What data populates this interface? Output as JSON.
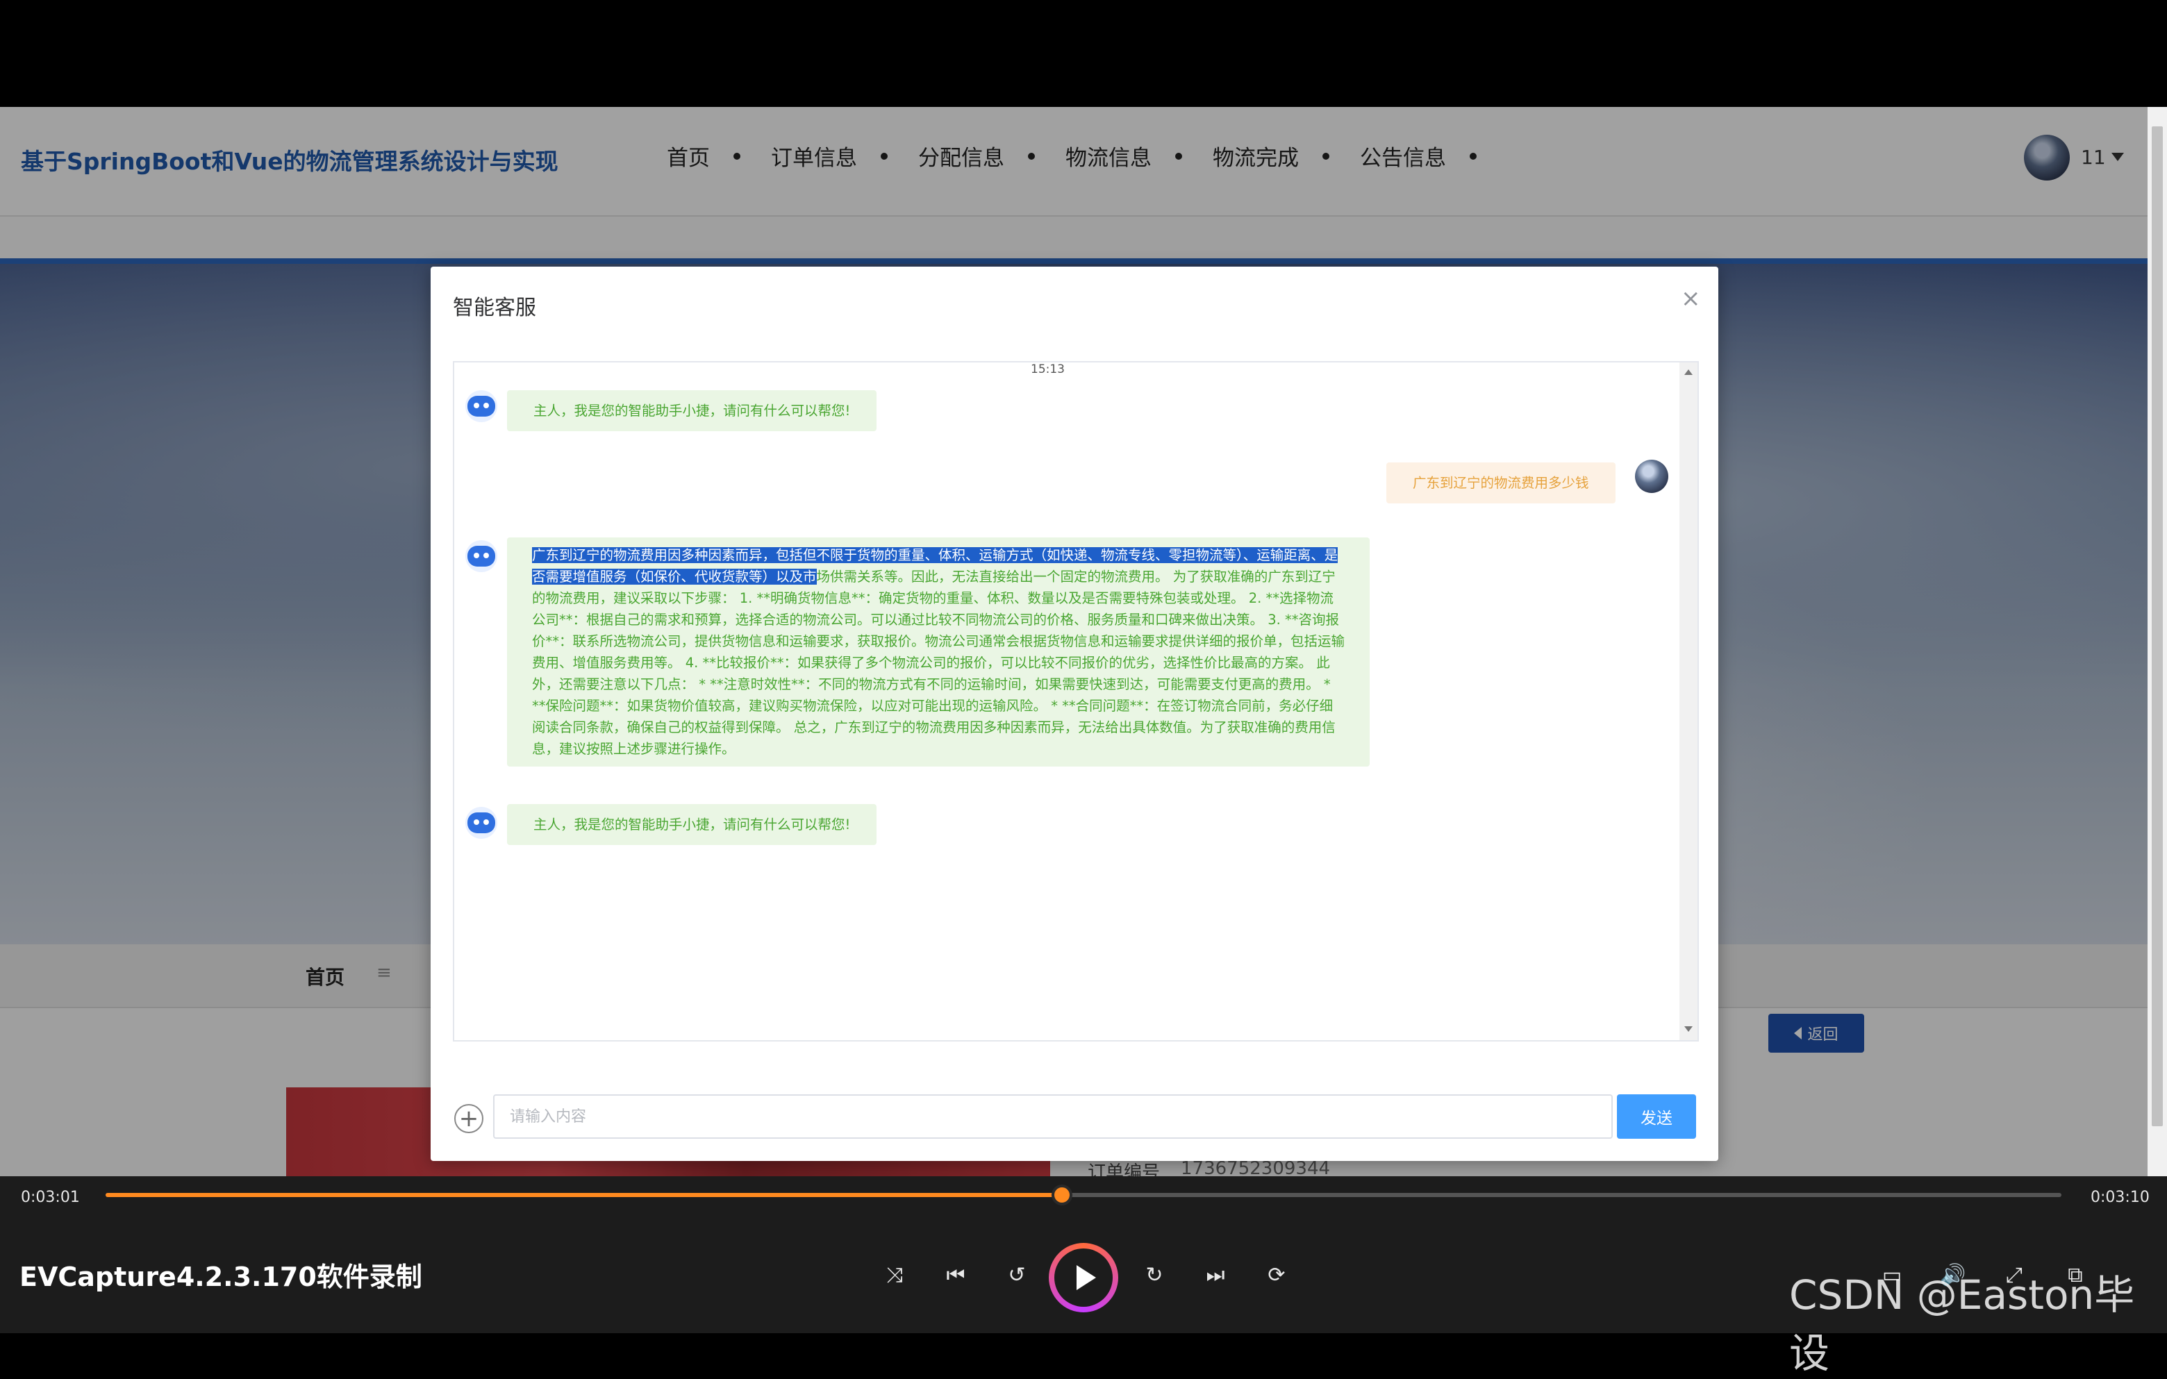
{
  "site": {
    "title": "基于SpringBoot和Vue的物流管理系统设计与实现",
    "nav": [
      "首页",
      "订单信息",
      "分配信息",
      "物流信息",
      "物流完成",
      "公告信息"
    ],
    "user_name": "11"
  },
  "page": {
    "breadcrumb_home": "首页",
    "breadcrumb_sep": "≡",
    "back_label": "返回",
    "order_no_label": "订单编号",
    "order_no_value": "1736752309344"
  },
  "modal": {
    "title": "智能客服",
    "close": "×",
    "time": "15:13",
    "bot_greeting": "主人，我是您的智能助手小捷，请问有什么可以帮您!",
    "user_message": "广东到辽宁的物流费用多少钱",
    "bot_answer_selected": "广东到辽宁的物流费用因多种因素而异，包括但不限于货物的重量、体积、运输方式（如快递、物流专线、零担物流等）、运输距离、是否需要增值服务（如保价、代收货款等）以及市",
    "bot_answer_rest": "场供需关系等。因此，无法直接给出一个固定的物流费用。 为了获取准确的广东到辽宁的物流费用，建议采取以下步骤： 1. **明确货物信息**：确定货物的重量、体积、数量以及是否需要特殊包装或处理。 2. **选择物流公司**：根据自己的需求和预算，选择合适的物流公司。可以通过比较不同物流公司的价格、服务质量和口碑来做出决策。 3. **咨询报价**：联系所选物流公司，提供货物信息和运输要求，获取报价。物流公司通常会根据货物信息和运输要求提供详细的报价单，包括运输费用、增值服务费用等。 4. **比较报价**：如果获得了多个物流公司的报价，可以比较不同报价的优劣，选择性价比最高的方案。 此外，还需要注意以下几点： * **注意时效性**：不同的物流方式有不同的运输时间，如果需要快速到达，可能需要支付更高的费用。 * **保险问题**：如果货物价值较高，建议购买物流保险，以应对可能出现的运输风险。 * **合同问题**：在签订物流合同前，务必仔细阅读合同条款，确保自己的权益得到保障。 总之，广东到辽宁的物流费用因多种因素而异，无法给出具体数值。为了获取准确的费用信息，建议按照上述步骤进行操作。",
    "input_placeholder": "请输入内容",
    "input_value": "",
    "send_label": "发送"
  },
  "player": {
    "time_current": "0:03:01",
    "time_total": "0:03:10",
    "progress_fraction": 0.489,
    "recorder_label": "EVCapture4.2.3.170软件录制",
    "watermark": "CSDN @Easton毕设",
    "controls": [
      "shuffle-icon",
      "previous-icon",
      "rewind-10-icon",
      "play-icon",
      "forward-30-icon",
      "next-icon",
      "repeat-icon",
      "subtitles-icon",
      "volume-icon",
      "expand-icon",
      "mini-player-icon"
    ],
    "accent_color": "#ff8a1f"
  }
}
